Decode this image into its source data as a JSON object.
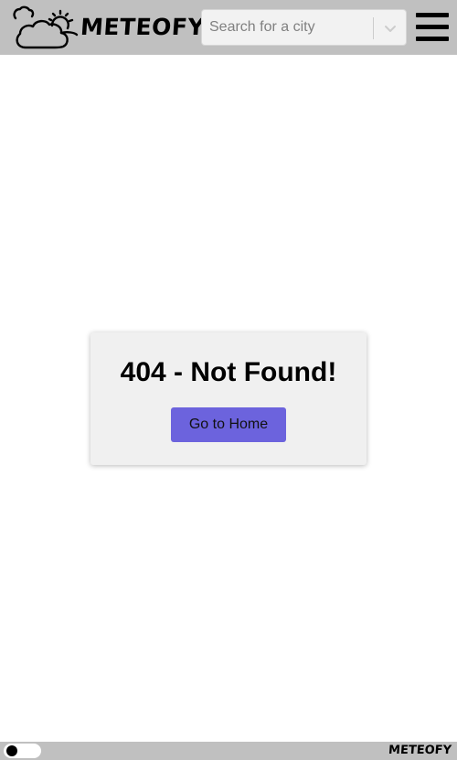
{
  "header": {
    "brand": "METEOFY",
    "search": {
      "placeholder": "Search for a city",
      "value": ""
    },
    "menu_icon": "hamburger-menu-icon",
    "logo_icon": "cloud-sun-logo-icon"
  },
  "main": {
    "title": "404 - Not Found!",
    "home_button_label": "Go to Home"
  },
  "footer": {
    "brand": "METEOFY",
    "theme_toggle": "dark-mode-toggle"
  },
  "colors": {
    "bar_background": "#c0c0c0",
    "card_background": "#f0f0f0",
    "accent_button": "#6c63dd"
  }
}
